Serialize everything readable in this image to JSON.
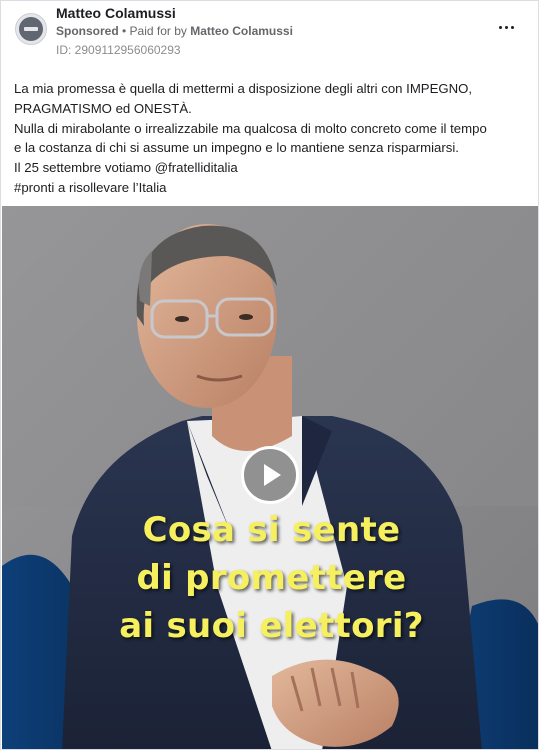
{
  "header": {
    "page_name": "Matteo Colamussi",
    "sponsored_label": "Sponsored",
    "paid_for_prefix": " • Paid for by ",
    "paid_for_name": "Matteo Colamussi",
    "ad_id": "ID: 2909112956060293",
    "avatar_icon": "blocked-profile-icon",
    "more_icon": "more-options-icon"
  },
  "post": {
    "lines": [
      "La mia promessa è quella di mettermi a disposizione degli altri con IMPEGNO,",
      "PRAGMATISMO ed ONESTÀ.",
      "Nulla di mirabolante o irrealizzabile ma qualcosa di molto concreto come il tempo",
      "e la costanza di chi si assume un impegno e lo mantiene senza risparmiarsi.",
      "Il 25 settembre votiamo @fratelliditalia",
      "#pronti a risollevare l’Italia"
    ]
  },
  "video": {
    "play_icon": "play-icon",
    "caption_lines": [
      "Cosa si sente",
      "di promettere",
      "ai suoi elettori?"
    ],
    "caption_color": "#f6ef5e"
  },
  "colors": {
    "text_primary": "#1c1e21",
    "text_secondary": "#65676b",
    "border": "#dadde1"
  }
}
